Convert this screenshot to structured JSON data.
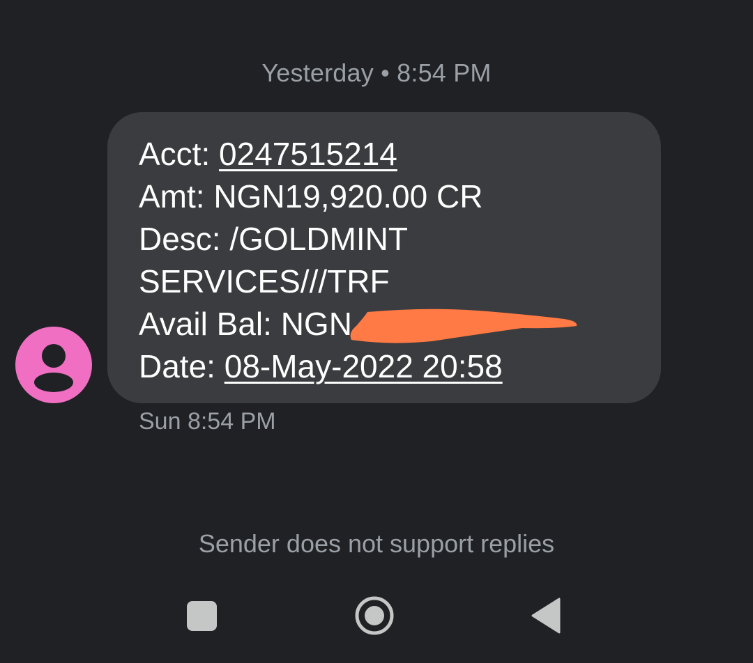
{
  "conversation": {
    "date_divider": "Yesterday • 8:54 PM",
    "message": {
      "acct_label": "Acct: ",
      "acct_number": "0247515214",
      "amount_line": "Amt: NGN19,920.00 CR",
      "desc_line1": "Desc: /GOLDMINT",
      "desc_line2": "SERVICES///TRF",
      "balance_label": "Avail Bal: NGN",
      "date_label": "Date: ",
      "date_value": "08-May-2022 20:58",
      "timestamp": "Sun 8:54 PM"
    },
    "reply_notice": "Sender does not support replies"
  },
  "colors": {
    "background": "#202124",
    "bubble": "#3b3c3f",
    "avatar": "#f06fc3",
    "redaction": "#ff7a45"
  },
  "icons": {
    "avatar": "person-icon",
    "recents": "square-icon",
    "home": "circle-icon",
    "back": "triangle-back-icon"
  }
}
